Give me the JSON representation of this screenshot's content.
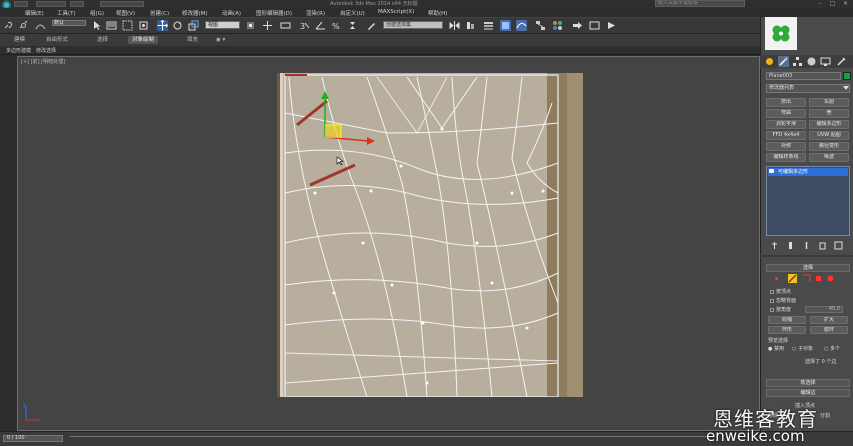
{
  "titlebar": {
    "title": "Autodesk 3ds Max 2014 x64   无标题",
    "search_placeholder": "键入关键字或短语",
    "workspace_label": "工作区: 默认",
    "minimize": "–",
    "maximize": "□",
    "close": "✕"
  },
  "menu": {
    "workspace_value": "默认",
    "items": [
      "编辑(E)",
      "工具(T)",
      "组(G)",
      "视图(V)",
      "创建(C)",
      "修改器(M)",
      "动画(A)",
      "图形编辑器(D)",
      "渲染(R)",
      "自定义(U)",
      "MAXScript(X)",
      "帮助(H)"
    ]
  },
  "toolbar": {
    "view_dropdown": "视图",
    "selection_set_placeholder": "创建选择集"
  },
  "ribbon": {
    "tabs": [
      "建模",
      "自由形式",
      "选择",
      "对象绘制",
      "填充"
    ],
    "active_index": 3,
    "extra": "◉ ▾"
  },
  "subribbon": {
    "items": [
      "多边形建模",
      "修改选择"
    ]
  },
  "viewport": {
    "label": "[+] [前] [明暗处理]"
  },
  "command_panel": {
    "object_name": "Plane003",
    "object_color": "#14a046",
    "modifier_list": "修改器列表",
    "modifier_buttons": [
      "挤出",
      "车削",
      "弯曲",
      "壳",
      "涡轮平滑",
      "编辑多边形",
      "FFD 4x4x4",
      "UVW 贴图",
      "对称",
      "路径变形",
      "编辑样条线",
      "噪波"
    ],
    "stack_item": "可编辑多边形",
    "selection_rollout_title": "选择",
    "checkbox_by_vertex": "按顶点",
    "checkbox_ignore_backfacing": "忽略背面",
    "checkbox_by_angle": "按角度",
    "angle_value": "45.0",
    "btn_shrink": "收缩",
    "btn_grow": "扩大",
    "btn_ring": "环形",
    "btn_loop": "循环",
    "preview_label": "预览选择",
    "preview_off": "禁用",
    "preview_subobj": "子对象",
    "preview_multi": "多个",
    "selected_count": "选择了 0 个边",
    "soft_selection": "软选择",
    "edit_edges": "编辑边",
    "insert_vertex": "插入顶点",
    "remove": "移除",
    "split": "分割"
  },
  "statusbar": {
    "timeslider": "0 / 100"
  },
  "watermark": {
    "cn": "恩维客教育",
    "url": "enweike.com"
  }
}
